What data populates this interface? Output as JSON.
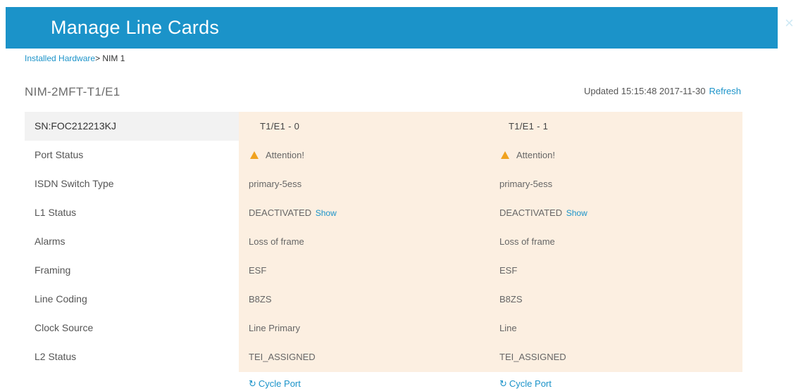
{
  "header": {
    "title": "Manage Line Cards",
    "close_glyph": "×"
  },
  "breadcrumb": {
    "parent": "Installed Hardware",
    "separator": ">",
    "current": " NIM 1"
  },
  "device": {
    "name": "NIM-2MFT-T1/E1",
    "updated_text": "Updated 15:15:48 2017-11-30",
    "refresh_label": "Refresh"
  },
  "labels": {
    "serial": "SN:FOC212213KJ",
    "port_status": "Port Status",
    "isdn_switch_type": "ISDN Switch Type",
    "l1_status": "L1 Status",
    "alarms": "Alarms",
    "framing": "Framing",
    "line_coding": "Line Coding",
    "clock_source": "Clock Source",
    "l2_status": "L2 Status"
  },
  "ports": [
    {
      "name": "T1/E1 - 0",
      "port_status": "Attention!",
      "isdn_switch_type": "primary-5ess",
      "l1_status": "DEACTIVATED",
      "l1_show": "Show",
      "alarms": "Loss of frame",
      "framing": "ESF",
      "line_coding": "B8ZS",
      "clock_source": "Line Primary",
      "l2_status": "TEI_ASSIGNED",
      "cycle_label": "Cycle Port"
    },
    {
      "name": "T1/E1 - 1",
      "port_status": "Attention!",
      "isdn_switch_type": "primary-5ess",
      "l1_status": "DEACTIVATED",
      "l1_show": "Show",
      "alarms": "Loss of frame",
      "framing": "ESF",
      "line_coding": "B8ZS",
      "clock_source": "Line",
      "l2_status": "TEI_ASSIGNED",
      "cycle_label": "Cycle Port"
    }
  ],
  "icons": {
    "warning": "warning-triangle-icon",
    "cycle": "refresh-circle-icon",
    "close": "close-icon"
  },
  "colors": {
    "header_bg": "#1b93c9",
    "link": "#1b93c9",
    "panel_bg": "#fcefe1",
    "warning": "#f0a21e"
  }
}
